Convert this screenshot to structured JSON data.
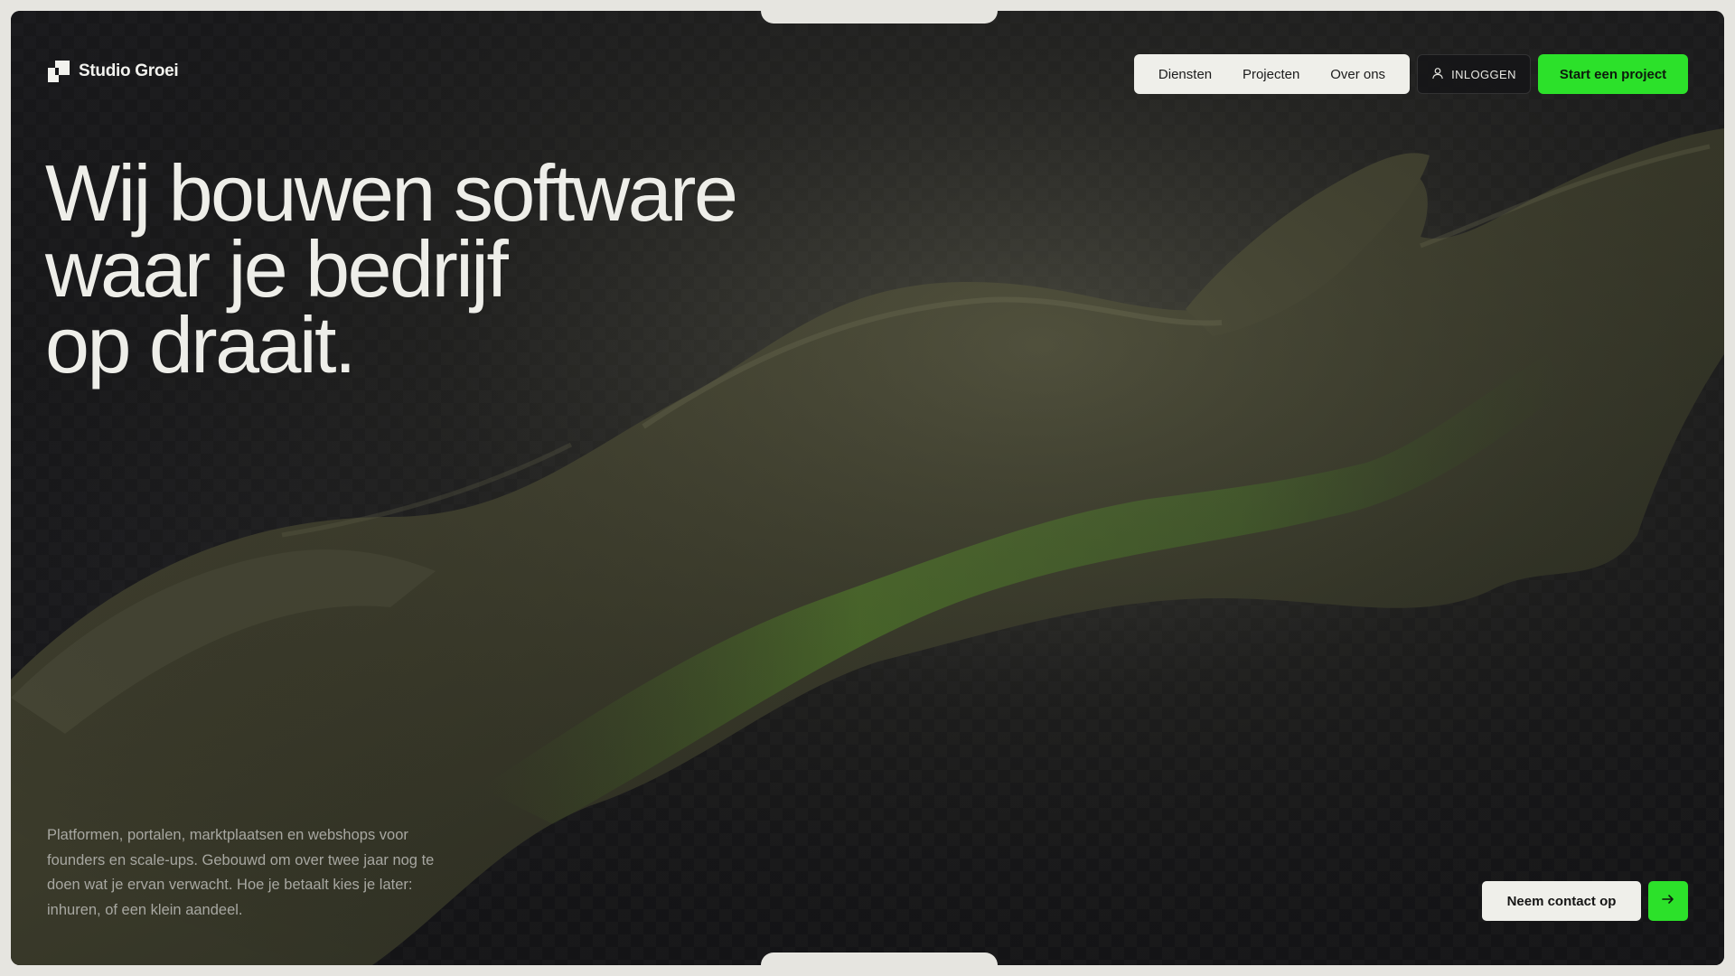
{
  "brand": {
    "name": "Studio Groei",
    "logo_icon": "studio-groei-logo-icon"
  },
  "nav": {
    "items": [
      "Diensten",
      "Projecten",
      "Over ons"
    ],
    "login_label": "INLOGGEN",
    "login_icon": "user-icon",
    "cta_label": "Start een project"
  },
  "hero": {
    "headline_lines": [
      "Wij bouwen software",
      "waar je bedrijf",
      "op draait."
    ],
    "description": "Platformen, portalen, marktplaatsen en webshops voor founders en scale-ups. Gebouwd om over twee jaar nog te doen wat je ervan verwacht. Hoe je betaalt kies je later: inhuren, of een klein aandeel.",
    "contact_label": "Neem contact op",
    "arrow_icon": "arrow-right-icon"
  },
  "colors": {
    "accent_green": "#2ce12a",
    "background_dark": "#17171a",
    "outer_frame": "#e6e5e0",
    "pill_light": "#efefea"
  }
}
